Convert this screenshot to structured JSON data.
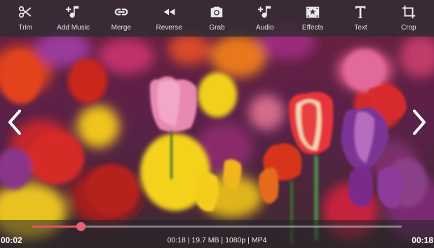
{
  "toolbar": {
    "items": [
      {
        "label": "Trim",
        "icon": "scissors-icon"
      },
      {
        "label": "Add Music",
        "icon": "add-music-icon"
      },
      {
        "label": "Merge",
        "icon": "link-icon"
      },
      {
        "label": "Reverse",
        "icon": "rewind-icon"
      },
      {
        "label": "Grab",
        "icon": "camera-icon"
      },
      {
        "label": "Audio",
        "icon": "audio-note-icon"
      },
      {
        "label": "Effects",
        "icon": "effects-icon"
      },
      {
        "label": "Text",
        "icon": "text-icon"
      },
      {
        "label": "Crop",
        "icon": "crop-icon"
      }
    ]
  },
  "navigation": {
    "previous_icon": "chevron-left-icon",
    "next_icon": "chevron-right-icon"
  },
  "player": {
    "current_time": "00:02",
    "total_time": "00:18",
    "progress_fraction": 0.13,
    "file_info": "00:18 | 19.7 MB | 1080p | MP4"
  },
  "colors": {
    "accent": "#e35466",
    "toolbar_bg": "#2d2d32"
  }
}
